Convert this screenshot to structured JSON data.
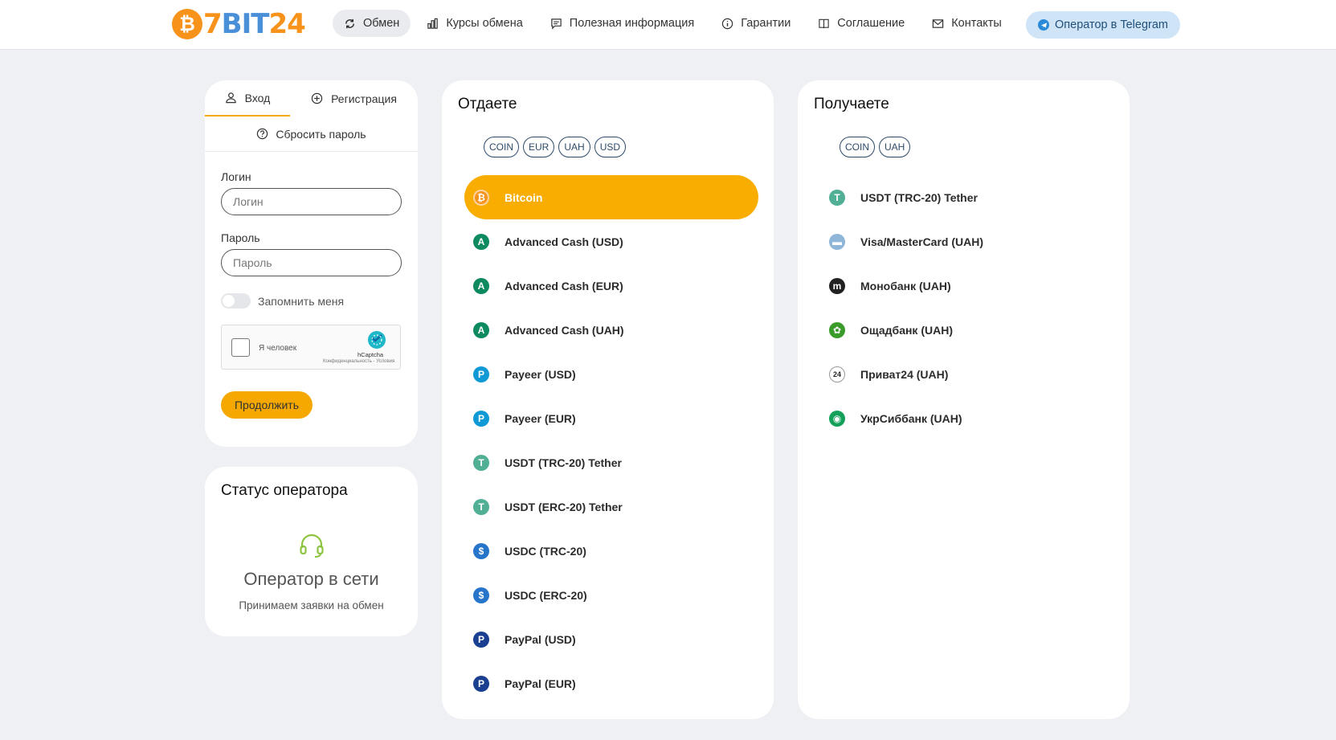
{
  "logo": {
    "coin": "₿",
    "seven": "7",
    "bit": "BIT",
    "num": "24"
  },
  "nav": {
    "items": [
      {
        "label": "Обмен"
      },
      {
        "label": "Курсы обмена"
      },
      {
        "label": "Полезная информация"
      },
      {
        "label": "Гарантии"
      },
      {
        "label": "Соглашение"
      },
      {
        "label": "Контакты"
      }
    ],
    "telegram": "Оператор в Telegram"
  },
  "login": {
    "tab_login": "Вход",
    "tab_register": "Регистрация",
    "reset": "Сбросить пароль",
    "login_label": "Логин",
    "login_placeholder": "Логин",
    "password_label": "Пароль",
    "password_placeholder": "Пароль",
    "remember": "Запомнить меня",
    "captcha_text": "Я человек",
    "captcha_brand": "hCaptcha",
    "captcha_links": "Конфиденциальность - Условия",
    "continue": "Продолжить"
  },
  "status": {
    "title": "Статус оператора",
    "main": "Оператор в сети",
    "sub": "Принимаем заявки на обмен"
  },
  "give": {
    "title": "Отдаете",
    "chips": [
      "COIN",
      "EUR",
      "UAH",
      "USD"
    ],
    "items": [
      {
        "label": "Bitcoin",
        "icon": "bitcoin-icon",
        "glyph": "₿",
        "color": "#f7931a",
        "selected": true
      },
      {
        "label": "Advanced Cash (USD)",
        "icon": "advcash-icon",
        "glyph": "A",
        "color": "#0d8a5f"
      },
      {
        "label": "Advanced Cash (EUR)",
        "icon": "advcash-icon",
        "glyph": "A",
        "color": "#0d8a5f"
      },
      {
        "label": "Advanced Cash (UAH)",
        "icon": "advcash-icon",
        "glyph": "A",
        "color": "#0d8a5f"
      },
      {
        "label": "Payeer (USD)",
        "icon": "payeer-icon",
        "glyph": "P",
        "color": "#0f9ad6"
      },
      {
        "label": "Payeer (EUR)",
        "icon": "payeer-icon",
        "glyph": "P",
        "color": "#0f9ad6"
      },
      {
        "label": "USDT (TRC-20) Tether",
        "icon": "tether-icon",
        "glyph": "T",
        "color": "#50af95"
      },
      {
        "label": "USDT (ERC-20) Tether",
        "icon": "tether-icon",
        "glyph": "T",
        "color": "#50af95"
      },
      {
        "label": "USDC (TRC-20)",
        "icon": "usdc-icon",
        "glyph": "$",
        "color": "#2775ca"
      },
      {
        "label": "USDC (ERC-20)",
        "icon": "usdc-icon",
        "glyph": "$",
        "color": "#2775ca"
      },
      {
        "label": "PayPal (USD)",
        "icon": "paypal-icon",
        "glyph": "P",
        "color": "#1a3f91"
      },
      {
        "label": "PayPal (EUR)",
        "icon": "paypal-icon",
        "glyph": "P",
        "color": "#1a3f91"
      }
    ]
  },
  "get": {
    "title": "Получаете",
    "chips": [
      "COIN",
      "UAH"
    ],
    "items": [
      {
        "label": "USDT (TRC-20) Tether",
        "icon": "tether-icon",
        "glyph": "T",
        "color": "#50af95"
      },
      {
        "label": "Visa/MasterCard (UAH)",
        "icon": "card-icon",
        "glyph": "▬",
        "color": "#8fb6d8"
      },
      {
        "label": "Монобанк (UAH)",
        "icon": "monobank-icon",
        "glyph": "m",
        "color": "#222222"
      },
      {
        "label": "Ощадбанк (UAH)",
        "icon": "oschadbank-icon",
        "glyph": "✿",
        "color": "#3a9a2a"
      },
      {
        "label": "Приват24 (UAH)",
        "icon": "privat24-icon",
        "glyph": "24",
        "color": "#ffffff"
      },
      {
        "label": "УкрСиббанк (UAH)",
        "icon": "ukrsibbank-icon",
        "glyph": "◉",
        "color": "#12a05a"
      }
    ]
  }
}
